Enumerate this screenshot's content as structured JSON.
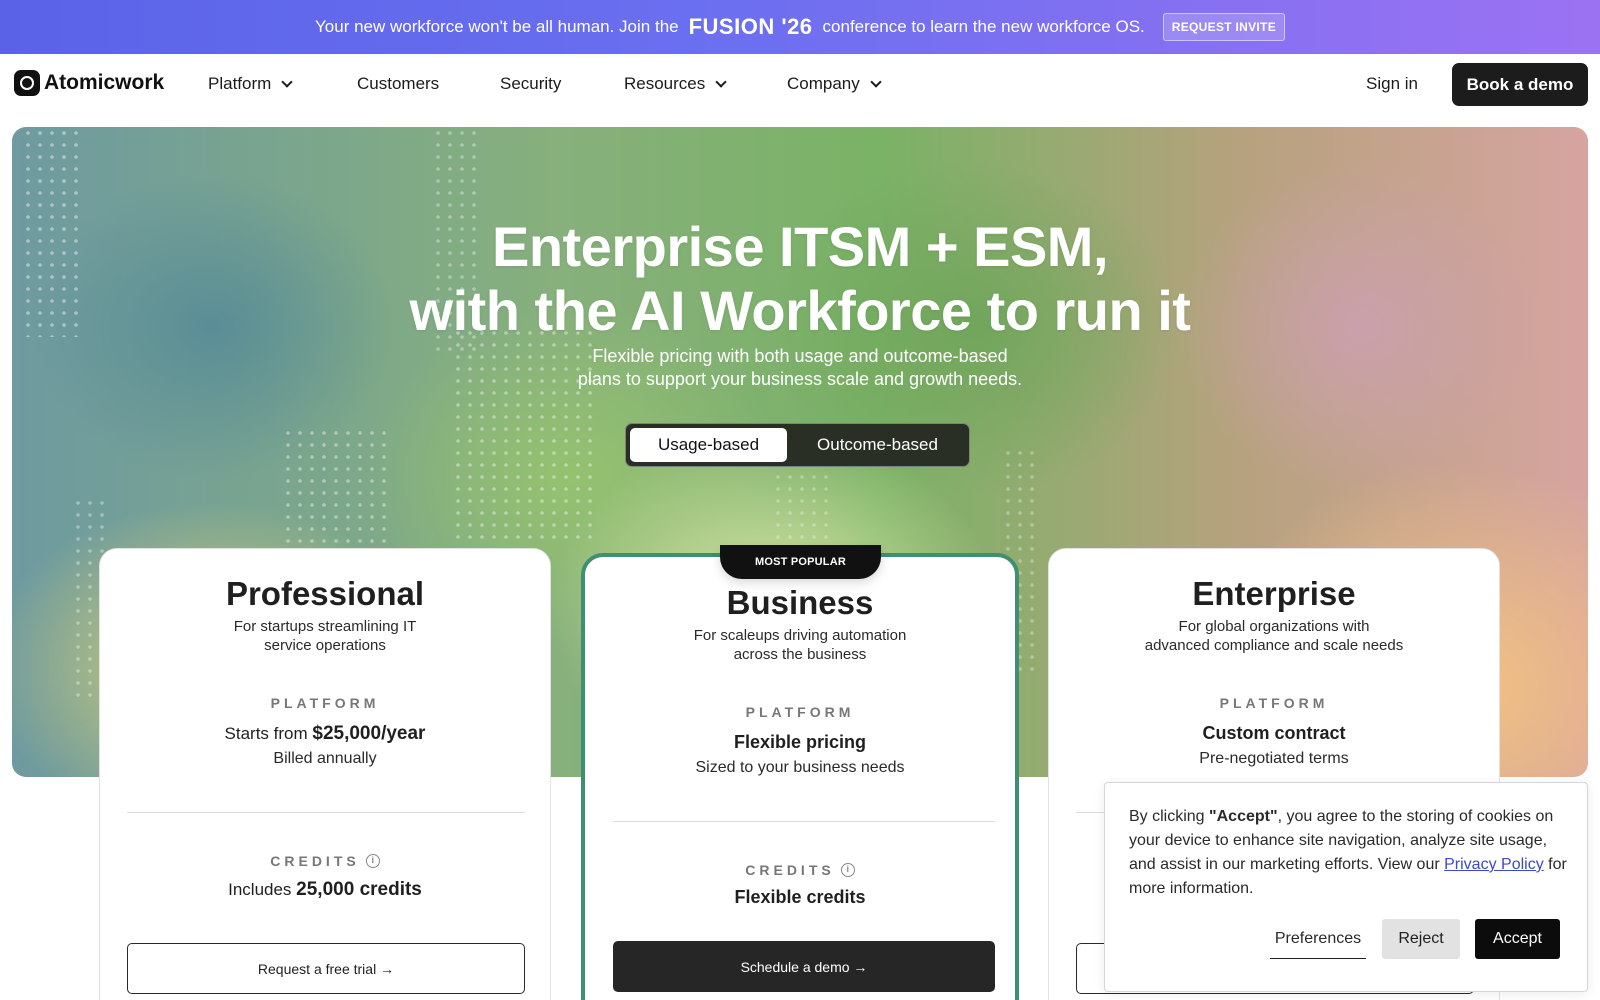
{
  "announcement": {
    "text_before": "Your new workforce won't be all human. Join the",
    "brand": "FUSION '26",
    "text_after": "conference to learn the new workforce OS.",
    "invite_label": "REQUEST INVITE"
  },
  "nav": {
    "logo_text": "Atomicwork",
    "items": [
      "Platform",
      "Customers",
      "Security",
      "Resources",
      "Company"
    ],
    "signin_label": "Sign in",
    "demo_label": "Book a demo"
  },
  "hero": {
    "title_line1": "Enterprise ITSM + ESM,",
    "title_line2": "with the AI Workforce to run it",
    "subtitle_line1": "Flexible pricing with both usage and outcome-based",
    "subtitle_line2": "plans to support your business scale and growth needs.",
    "toggle": {
      "active": "Usage-based",
      "inactive": "Outcome-based"
    }
  },
  "plans": [
    {
      "name": "Professional",
      "desc_line1": "For startups streamlining IT",
      "desc_line2": "service operations",
      "platform_label": "PLATFORM",
      "price_prefix": "Starts from",
      "price": "$25,000/year",
      "price_note": "Billed annually",
      "credits_label": "CREDITS",
      "credits_prefix": "Includes",
      "credits_value": "25,000 credits",
      "cta": "Request a free trial →"
    },
    {
      "name": "Business",
      "badge": "MOST POPULAR",
      "desc_line1": "For scaleups driving automation",
      "desc_line2": "across the business",
      "platform_label": "PLATFORM",
      "price": "Flexible pricing",
      "price_note": "Sized to your business needs",
      "credits_label": "CREDITS",
      "credits_value": "Flexible credits",
      "cta": "Schedule a demo →"
    },
    {
      "name": "Enterprise",
      "desc_line1": "For global organizations with",
      "desc_line2": "advanced compliance and scale needs",
      "platform_label": "PLATFORM",
      "price": "Custom contract",
      "price_note": "Pre-negotiated terms"
    }
  ],
  "cookie": {
    "text_1": "By clicking",
    "accept_quoted": "\"Accept\"",
    "text_2": ", you agree to the storing of cookies on your device to enhance site navigation, analyze site usage, and assist in our marketing efforts. View our",
    "link": "Privacy Policy",
    "text_3": "for more information.",
    "preferences": "Preferences",
    "reject": "Reject",
    "accept": "Accept"
  }
}
